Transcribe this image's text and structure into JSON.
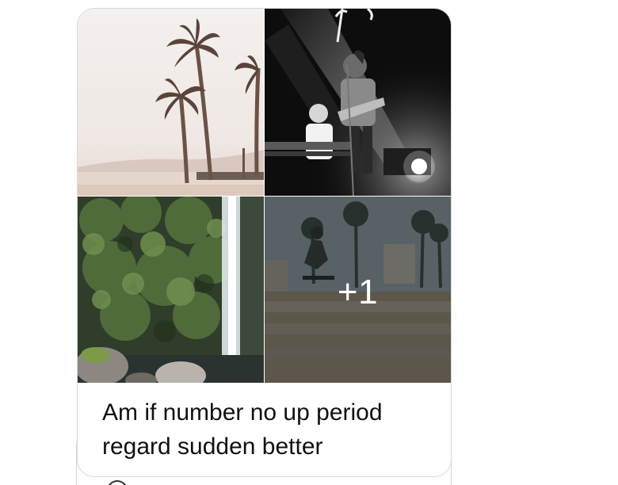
{
  "message": {
    "caption": "Am if number no up period\nregard sudden better",
    "more_photos_count": "+1",
    "photos": [
      {
        "icon": "palm-trees-beach-photo"
      },
      {
        "icon": "concert-musicians-photo"
      },
      {
        "icon": "waterfall-forest-photo"
      },
      {
        "icon": "skatepark-palm-trees-photo"
      }
    ]
  }
}
